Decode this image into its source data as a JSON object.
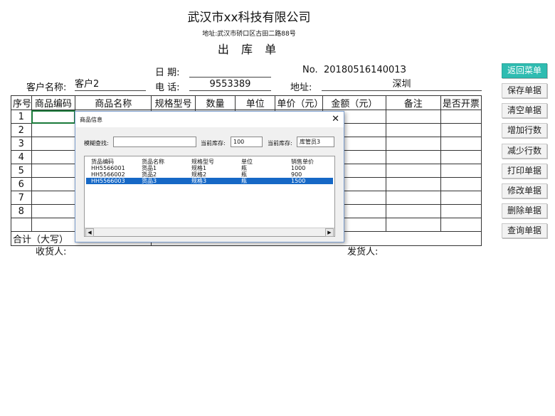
{
  "header": {
    "company": "武汉市xx科技有限公司",
    "address": "地址:武汉市硚口区古田二路88号",
    "title": "出 库 单"
  },
  "info": {
    "date_label": "日  期:",
    "date_value": "",
    "no_label": "No.",
    "no_value": "2018051614001З",
    "customer_label": "客户名称:",
    "customer_value": "客户2",
    "phone_label": "电  话:",
    "phone_value": "9553389",
    "addr_label": "地址:",
    "addr_value": "深圳"
  },
  "table": {
    "columns": [
      "序号",
      "商品编码",
      "商品名称",
      "规格型号",
      "数量",
      "单位",
      "单价（元）",
      "金额（元）",
      "备注",
      "是否开票"
    ],
    "row_numbers": [
      "1",
      "2",
      "3",
      "4",
      "5",
      "6",
      "7",
      "8",
      ""
    ],
    "total_label": "合计（大写）"
  },
  "footer": {
    "receiver_label": "收货人:",
    "sender_label": "发货人:"
  },
  "buttons": {
    "back": "返回菜单",
    "save": "保存单据",
    "clear": "清空单据",
    "add_row": "增加行数",
    "remove_row": "减少行数",
    "print": "打印单据",
    "modify": "修改单据",
    "delete": "删除单据",
    "query": "查询单据"
  },
  "dialog": {
    "title": "商品信息",
    "fuzzy_label": "模糊查找:",
    "fuzzy_value": "",
    "stock_label": "当前库存:",
    "stock_value": "100",
    "stock2_label": "当前库存:",
    "stock2_value": "库管员3",
    "list_headers": [
      "货品编码",
      "货品名称",
      "规格型号",
      "单位",
      "销售单价"
    ],
    "list_rows": [
      [
        "HH5566001",
        "货品1",
        "规格1",
        "瓶",
        "1000"
      ],
      [
        "HH5566002",
        "货品2",
        "规格2",
        "瓶",
        "900"
      ],
      [
        "HH5566003",
        "货品3",
        "规格3",
        "瓶",
        "1500"
      ]
    ],
    "selected_row": 2
  },
  "colors": {
    "accent": "#2fbcb1",
    "selection": "#1668c6"
  }
}
